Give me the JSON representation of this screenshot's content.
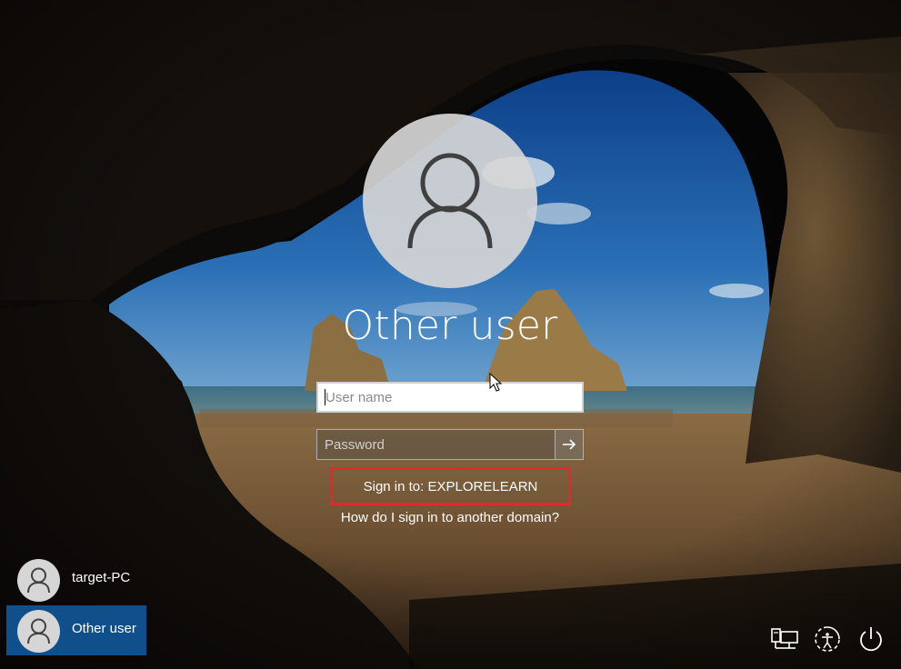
{
  "login": {
    "display_name": "Other user",
    "username_placeholder": "User name",
    "password_placeholder": "Password",
    "sign_in_to": "Sign in to: EXPLORELEARN",
    "domain_help": "How do I sign in to another domain?"
  },
  "user_list": [
    {
      "label": "target-PC",
      "selected": false
    },
    {
      "label": "Other user",
      "selected": true
    }
  ],
  "system_icons": [
    "network-icon",
    "ease-of-access-icon",
    "power-icon"
  ],
  "colors": {
    "selected_tile": "#0f4f8c",
    "highlight_box": "#e8262a",
    "avatar_bg": "#d6d6d6"
  }
}
